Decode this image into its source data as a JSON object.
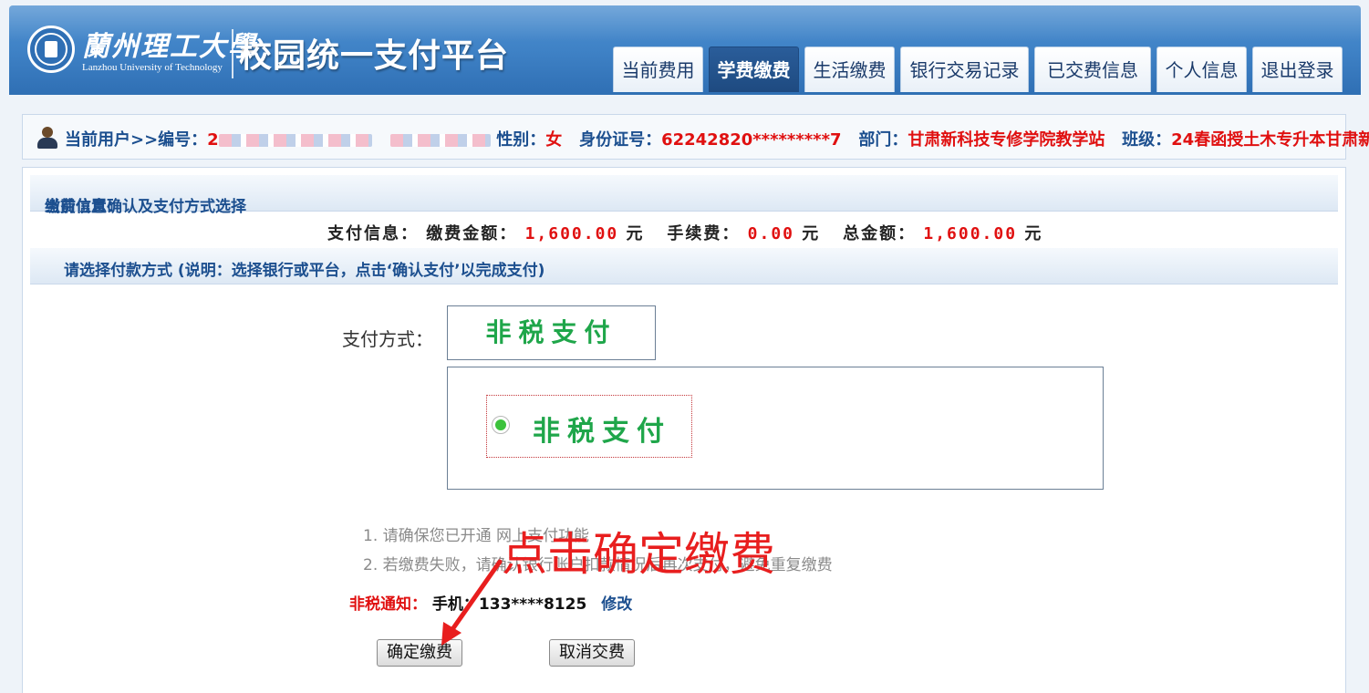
{
  "header": {
    "univ_name_cn": "蘭州理工大學",
    "univ_name_en": "Lanzhou University of Technology",
    "platform_title": "校园统一支付平台",
    "nav_tabs": [
      {
        "label": "当前费用",
        "active": false
      },
      {
        "label": "学费缴费",
        "active": true
      },
      {
        "label": "生活缴费",
        "active": false
      },
      {
        "label": "银行交易记录",
        "active": false
      },
      {
        "label": "已交费信息",
        "active": false
      },
      {
        "label": "个人信息",
        "active": false
      },
      {
        "label": "退出登录",
        "active": false
      }
    ]
  },
  "user_info": {
    "current_user_label": "当前用户>>",
    "id_label": "编号：",
    "id_value_visible": "2",
    "gender_label": "性别：",
    "gender_value": "女",
    "idcard_label": "身份证号：",
    "idcard_value": "62242820*********7",
    "dept_label": "部门：",
    "dept_value": "甘肃新科技专修学院教学站",
    "class_label": "班级：",
    "class_value": "24春函授土木专升本甘肃新"
  },
  "location": {
    "label": "当前位置：",
    "value": "缴费信息确认及支付方式选择"
  },
  "payment_info": {
    "label": "支付信息：",
    "amount_label": "缴费金额：",
    "amount_value": "1,600.00",
    "fee_label": "手续费：",
    "fee_value": "0.00",
    "total_label": "总金额：",
    "total_value": "1,600.00",
    "currency": "元"
  },
  "select_method_bar": "请选择付款方式 (说明：选择银行或平台，点击‘确认支付’以完成支付)",
  "method": {
    "label": "支付方式：",
    "selected": "非税支付",
    "options": [
      {
        "label": "非税支付",
        "selected": true
      }
    ]
  },
  "notes": [
    "1. 请确保您已开通 网上支付功能",
    "2. 若缴费失败，请确认银行账户扣款情况后再次支付，避免重复缴费"
  ],
  "sms_notice": {
    "label": "非税通知：",
    "phone_label": "手机：",
    "phone_value": "133****8125",
    "edit_label": "修改"
  },
  "buttons": {
    "confirm": "确定缴费",
    "cancel": "取消交费"
  },
  "annotation": "点击确定缴费",
  "colors": {
    "header_blue": "#3f82c6",
    "active_tab": "#1e4a80",
    "label_blue": "#1c4f8f",
    "value_red": "#e01010",
    "pay_green": "#1fa64a",
    "annotation_red": "#e81e1e"
  }
}
